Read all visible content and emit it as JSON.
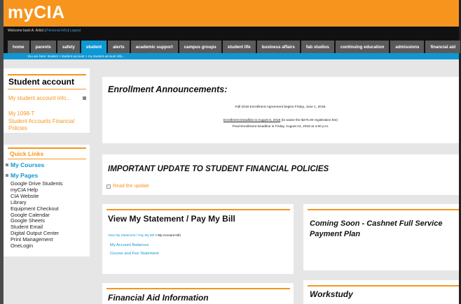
{
  "header": {
    "logo": "myCIA",
    "welcome": "Welcome back A. Artist",
    "personal_info": "Personal Info",
    "logout": "Logout"
  },
  "nav": {
    "tabs": [
      {
        "label": "home"
      },
      {
        "label": "parents"
      },
      {
        "label": "safety"
      },
      {
        "label": "student",
        "active": true
      },
      {
        "label": "alerts"
      },
      {
        "label": "academic support"
      },
      {
        "label": "campus groups"
      },
      {
        "label": "student life"
      },
      {
        "label": "business affairs"
      },
      {
        "label": "fab studios"
      },
      {
        "label": "continuing education"
      },
      {
        "label": "admissions"
      },
      {
        "label": "financial aid"
      }
    ]
  },
  "breadcrumb": {
    "prefix": "You are here:",
    "items": [
      "student",
      "student account",
      "my student account info..."
    ]
  },
  "sidebar": {
    "title": "Student account",
    "links": [
      "My student account info...",
      "My 1098-T",
      "Student Accounts Financial Policies"
    ],
    "quick_links_title": "Quick Links",
    "my_courses": "My Courses",
    "my_pages": "My Pages",
    "pages": [
      "Google Drive Students",
      "myCIA Help",
      "CIA Website",
      "Library",
      "Equipment Checkout",
      "Google Calendar",
      "Google Sheets",
      "Student Email",
      "Digital Output Center",
      "Print Management",
      "OneLogin"
    ]
  },
  "enrollment": {
    "title": "Enrollment Announcements:",
    "line1": "Fall 2018 Enrollment Agreement begins Friday, June 1, 2018.",
    "line2_underlined": "Enrollment Deadline is August 6, 2018",
    "line2_rest": " (to waive the $275.00 registration fee)",
    "line3": "Final Enrollment Deadline is Friday, August 24, 2018 at 4:00 p.m."
  },
  "important": {
    "title": "IMPORTANT UPDATE TO STUDENT FINANCIAL POLICIES",
    "link": "Read the update"
  },
  "statement": {
    "title": "View My Statement / Pay My Bill",
    "crumb_link": "View My Statement / Pay My Bill",
    "crumb_rest": " > My Account Info",
    "links": [
      "My Account Balances",
      "Course and Fee Statement"
    ]
  },
  "cashnet": {
    "title_line1": "Coming Soon - Cashnet Full Service",
    "title_line2": "Payment Plan"
  },
  "financial_aid": {
    "title": "Financial Aid Information"
  },
  "workstudy": {
    "title": "Workstudy"
  },
  "colors": {
    "brand_orange": "#f7941d",
    "accent_blue": "#0f97d4",
    "nav_dark": "#111111"
  }
}
